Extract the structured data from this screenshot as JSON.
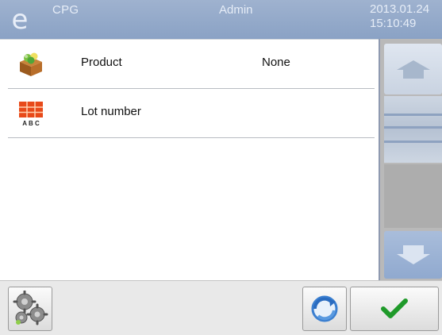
{
  "header": {
    "logo_glyph": "e",
    "app_name": "CPG",
    "user": "Admin",
    "date": "2013.01.24",
    "time": "15:10:49"
  },
  "list": {
    "items": [
      {
        "icon": "product-box-icon",
        "label": "Product",
        "value": "None"
      },
      {
        "icon": "lot-number-abc-icon",
        "label": "Lot number",
        "value": ""
      }
    ]
  },
  "scrollbar": {
    "up_icon": "scroll-up-arrow-icon",
    "down_icon": "scroll-down-arrow-icon"
  },
  "toolbar": {
    "settings_icon": "gears-icon",
    "refresh_icon": "refresh-icon",
    "ok_icon": "checkmark-icon"
  },
  "colors": {
    "header": "#8aa2c5",
    "accent_green": "#1f9a2a",
    "scroll_button": "#9fb4d6"
  }
}
